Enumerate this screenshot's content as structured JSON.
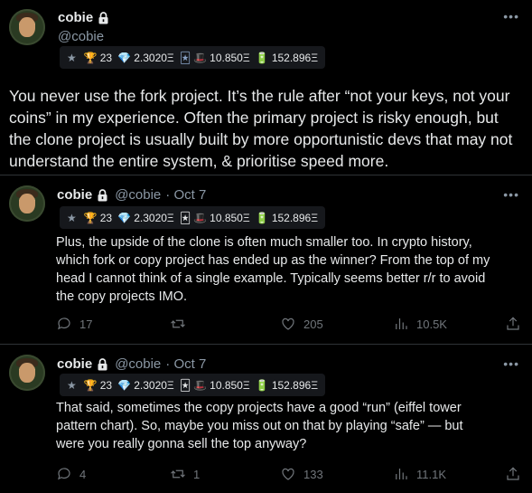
{
  "main_tweet": {
    "name": "cobie",
    "handle": "@cobie",
    "badge": {
      "trophy": "23",
      "diamond": "2.3020Ξ",
      "cards": "10.850Ξ",
      "battery": "152.896Ξ"
    },
    "text_lines": [
      "You never use the fork project. It’s the rule after “not your keys, not your",
      "coins” in my experience. Often the primary project is risky enough, but",
      "the clone project is usually built by more opportunistic devs that may not",
      "understand the entire system, & prioritise speed more."
    ]
  },
  "replies": [
    {
      "name": "cobie",
      "handle": "@cobie",
      "date": "· Oct 7",
      "badge": {
        "trophy": "23",
        "diamond": "2.3020Ξ",
        "cards": "10.850Ξ",
        "battery": "152.896Ξ"
      },
      "text_lines": [
        "Plus, the upside of the clone is often much smaller too. In crypto history,",
        "which fork or copy project has ended up as the winner? From the top of my",
        "head I cannot think of a single example. Typically seems better r/r to avoid",
        "the copy projects IMO."
      ],
      "replies_count": "17",
      "retweets_count": "",
      "likes_count": "205",
      "views_count": "10.5K"
    },
    {
      "name": "cobie",
      "handle": "@cobie",
      "date": "· Oct 7",
      "badge": {
        "trophy": "23",
        "diamond": "2.3020Ξ",
        "cards": "10.850Ξ",
        "battery": "152.896Ξ"
      },
      "text_lines": [
        "That said, sometimes the copy projects have a good “run” (eiffel tower",
        "pattern chart). So, maybe you miss out on that by playing “safe” — but",
        "were you really gonna sell the top anyway?"
      ],
      "replies_count": "4",
      "retweets_count": "1",
      "likes_count": "133",
      "views_count": "11.1K"
    }
  ],
  "icons": {
    "more": "more-icon",
    "lock": "lock-icon",
    "star": "star-icon",
    "trophy": "trophy-icon",
    "diamond": "diamond-icon",
    "cards": "cards-icon",
    "hat": "hat-icon",
    "battery": "battery-icon",
    "reply": "reply-icon",
    "retweet": "retweet-icon",
    "like": "heart-icon",
    "views": "views-icon",
    "share": "share-icon"
  },
  "colors": {
    "background": "#000000",
    "text": "#e7e9ea",
    "muted": "#71767b",
    "divider": "#2f3336",
    "badge_bg": "#16181c"
  }
}
